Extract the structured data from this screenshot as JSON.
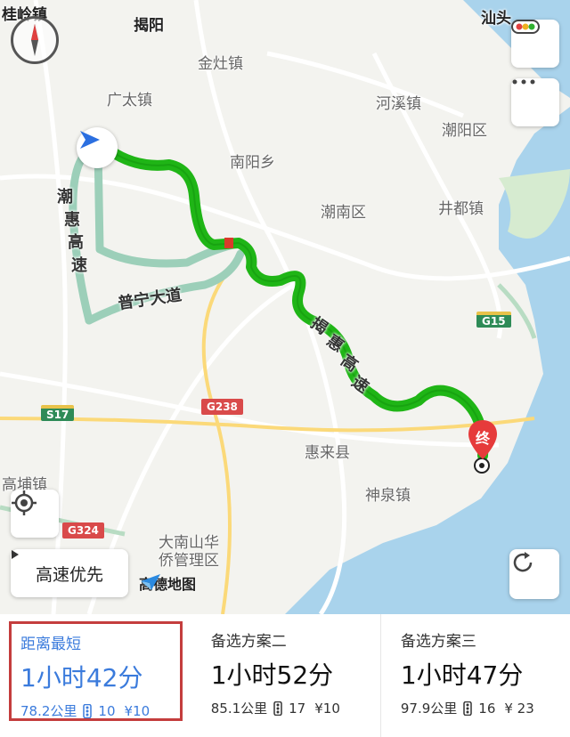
{
  "map": {
    "places": [
      {
        "id": "guiling",
        "name": "桂岭镇",
        "style": "dark"
      },
      {
        "id": "jieyang",
        "name": "揭阳",
        "style": "dark"
      },
      {
        "id": "shantou",
        "name": "汕头",
        "style": "dark"
      },
      {
        "id": "jinzao",
        "name": "金灶镇",
        "style": "normal"
      },
      {
        "id": "guangtai",
        "name": "广太镇",
        "style": "normal"
      },
      {
        "id": "hexi",
        "name": "河溪镇",
        "style": "normal"
      },
      {
        "id": "chaoyang",
        "name": "潮阳区",
        "style": "normal"
      },
      {
        "id": "nanyang",
        "name": "南阳乡",
        "style": "normal"
      },
      {
        "id": "chaonan",
        "name": "潮南区",
        "style": "normal"
      },
      {
        "id": "jingdu",
        "name": "井都镇",
        "style": "normal"
      },
      {
        "id": "huilai",
        "name": "惠来县",
        "style": "normal"
      },
      {
        "id": "gaopu",
        "name": "高埔镇",
        "style": "normal"
      },
      {
        "id": "shenquan",
        "name": "神泉镇",
        "style": "normal"
      },
      {
        "id": "danan",
        "name": "大南山华\n侨管理区",
        "style": "normal"
      }
    ],
    "roads": {
      "chaohui": [
        "潮",
        "惠",
        "高",
        "速"
      ],
      "puning": "普宁大道",
      "jiehui": [
        "揭",
        "惠",
        "高",
        "速"
      ]
    },
    "badges": {
      "s17": "S17",
      "g238": "G238",
      "g324": "G324",
      "g15": "G15"
    },
    "destination_label": "终",
    "route_mode": "高速优先",
    "logo_text": "高德地图",
    "colors": {
      "route_main": "#1fb516",
      "route_alt": "#9ccfb9",
      "water": "#a9d3ec",
      "selected_border": "#c43d3d",
      "selected_text": "#3b7bdc"
    },
    "icons": [
      "compass-icon",
      "traffic-icon",
      "more-icon",
      "location-icon",
      "refresh-icon",
      "navigation-arrow-icon",
      "destination-pin-icon"
    ]
  },
  "routes": [
    {
      "label": "距离最短",
      "time": "1小时42分",
      "distance": "78.2公里",
      "lights": "10",
      "toll": "¥10",
      "selected": true
    },
    {
      "label": "备选方案二",
      "time": "1小时52分",
      "distance": "85.1公里",
      "lights": "17",
      "toll": "¥10",
      "selected": false
    },
    {
      "label": "备选方案三",
      "time": "1小时47分",
      "distance": "97.9公里",
      "lights": "16",
      "toll": "¥ 23",
      "selected": false
    }
  ]
}
